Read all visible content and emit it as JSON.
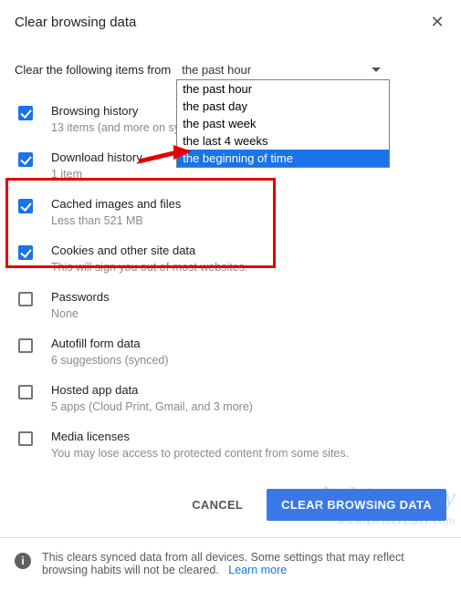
{
  "dialog": {
    "title": "Clear browsing data",
    "from_label": "Clear the following items from",
    "selected": "the past hour",
    "options": [
      "the past hour",
      "the past day",
      "the past week",
      "the last 4 weeks",
      "the beginning of time"
    ],
    "highlighted_option_index": 4
  },
  "items": [
    {
      "checked": true,
      "title": "Browsing history",
      "sub": "13 items (and more on synced devices)"
    },
    {
      "checked": true,
      "title": "Download history",
      "sub": "1 item"
    },
    {
      "checked": true,
      "title": "Cached images and files",
      "sub": "Less than 521 MB"
    },
    {
      "checked": true,
      "title": "Cookies and other site data",
      "sub": "This will sign you out of most websites."
    },
    {
      "checked": false,
      "title": "Passwords",
      "sub": "None"
    },
    {
      "checked": false,
      "title": "Autofill form data",
      "sub": "6 suggestions (synced)"
    },
    {
      "checked": false,
      "title": "Hosted app data",
      "sub": "5 apps (Cloud Print, Gmail, and 3 more)"
    },
    {
      "checked": false,
      "title": "Media licenses",
      "sub": "You may lose access to protected content from some sites."
    }
  ],
  "buttons": {
    "cancel": "CANCEL",
    "confirm": "CLEAR BROWSING DATA"
  },
  "footer": {
    "text": "This clears synced data from all devices. Some settings that may reflect browsing habits will not be cleared.",
    "link": "Learn more"
  },
  "watermark": {
    "line1": "driver easy",
    "line2": "www.DriverEasy.com"
  },
  "annotation": {
    "highlight_item_indices": [
      2,
      3
    ]
  }
}
